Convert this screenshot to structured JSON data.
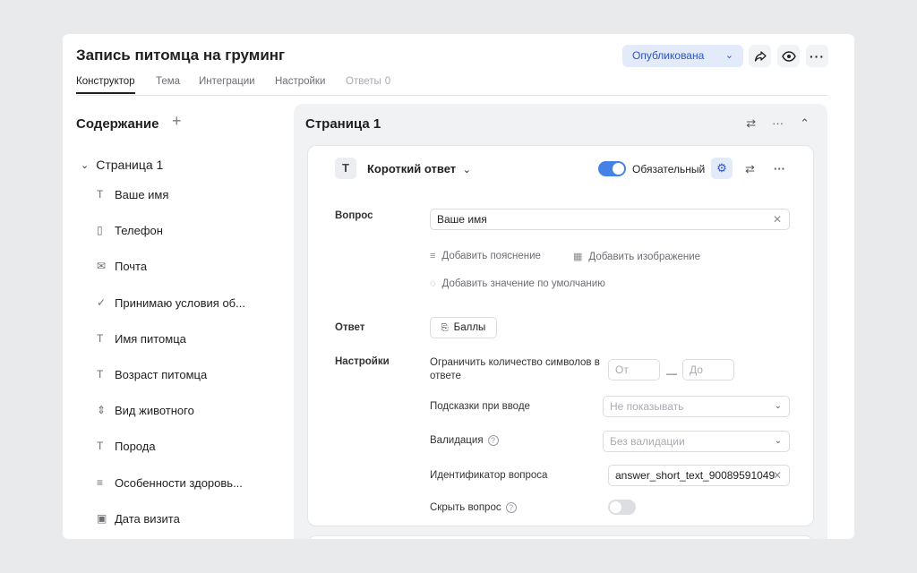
{
  "title": "Запись питомца на груминг",
  "status": "Опубликована",
  "tabs": [
    {
      "label": "Конструктор"
    },
    {
      "label": "Тема"
    },
    {
      "label": "Интеграции"
    },
    {
      "label": "Настройки"
    },
    {
      "label": "Ответы",
      "count": "0"
    }
  ],
  "sidebar": {
    "title": "Содержание",
    "page": "Страница 1",
    "items": [
      {
        "icon": "text-icon",
        "label": "Ваше имя"
      },
      {
        "icon": "phone-icon",
        "label": "Телефон"
      },
      {
        "icon": "mail-icon",
        "label": "Почта"
      },
      {
        "icon": "check-icon",
        "label": "Принимаю условия об..."
      },
      {
        "icon": "text-icon",
        "label": "Имя питомца"
      },
      {
        "icon": "text-icon",
        "label": "Возраст питомца"
      },
      {
        "icon": "sort-icon",
        "label": "Вид животного"
      },
      {
        "icon": "text-icon",
        "label": "Порода"
      },
      {
        "icon": "paragraph-icon",
        "label": "Особенности здоровь..."
      },
      {
        "icon": "calendar-icon",
        "label": "Дата визита"
      }
    ]
  },
  "main": {
    "page_title": "Страница 1",
    "question_type": "Короткий ответ",
    "required_label": "Обязательный",
    "question_label": "Вопрос",
    "question_value": "Ваше имя",
    "add_hint": "Добавить пояснение",
    "add_image": "Добавить изображение",
    "add_default": "Добавить значение по умолчанию",
    "answer_label": "Ответ",
    "score_label": "Баллы",
    "settings_label": "Настройки",
    "limit_label": "Ограничить количество символов в ответе",
    "from_placeholder": "От",
    "to_placeholder": "До",
    "hints_label": "Подсказки при вводе",
    "hints_value": "Не показывать",
    "validation_label": "Валидация",
    "validation_value": "Без валидации",
    "id_label": "Идентификатор вопроса",
    "id_value": "answer_short_text_90089591049",
    "hide_label": "Скрыть вопрос",
    "required_on": true,
    "hide_on": false
  }
}
